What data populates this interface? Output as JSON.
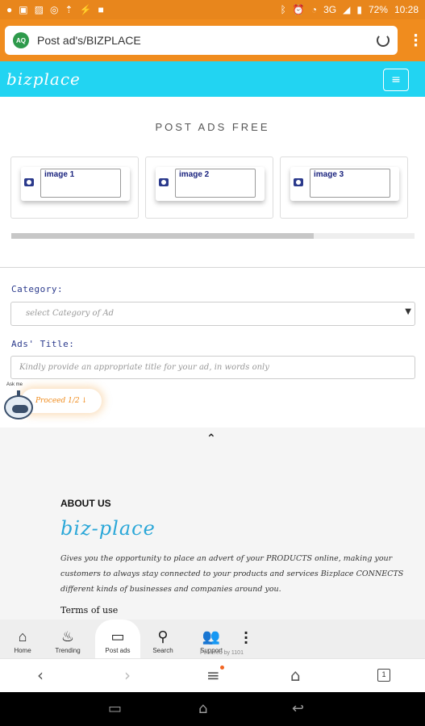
{
  "status_bar": {
    "battery": "72%",
    "time": "10:28",
    "network": "3G"
  },
  "browser": {
    "site_badge": "AQ",
    "url_title": "Post ad's/BIZPLACE"
  },
  "header": {
    "logo": "bizplace",
    "menu_icon": "≡"
  },
  "page": {
    "title": "POST ADS FREE",
    "image_slots": [
      {
        "label": "image 1"
      },
      {
        "label": "image 2"
      },
      {
        "label": "image 3"
      }
    ],
    "upload_progress": 0.75
  },
  "form": {
    "category_label": "Category:",
    "category_placeholder": "select Category of Ad",
    "title_label": "Ads' Title:",
    "title_placeholder": "Kindly provide an appropriate title for your ad, in words only",
    "proceed_label": "Proceed 1/2"
  },
  "chatbot": {
    "ask_me": "Ask me"
  },
  "footer": {
    "about_title": "ABOUT US",
    "about_logo": "biz-place",
    "about_text": "Gives you the opportunity to place an advert of your PRODUCTS online, making your customers to always stay connected to your products and services Bizplace CONNECTS different kinds of businesses and companies around you.",
    "terms": "Terms of use"
  },
  "bottom_nav": {
    "items": [
      {
        "label": "Home",
        "icon": "home-icon"
      },
      {
        "label": "Trending",
        "icon": "flame-icon"
      },
      {
        "label": "Post ads",
        "icon": "post-ad-icon"
      },
      {
        "label": "Search",
        "icon": "search-icon"
      },
      {
        "label": "Support",
        "icon": "people-icon"
      }
    ],
    "powered": "Powered by 1101"
  },
  "browser_toolbar": {
    "tab_count": "1"
  }
}
